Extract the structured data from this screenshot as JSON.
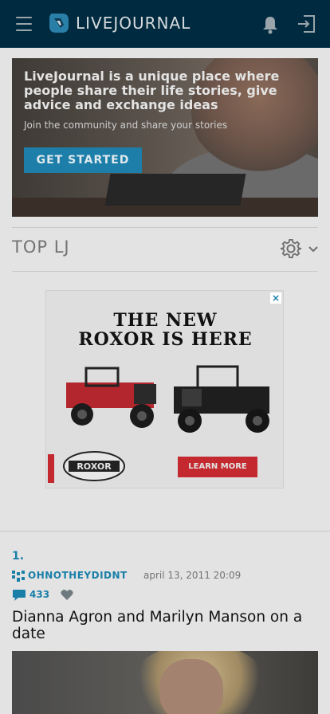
{
  "header": {
    "logo_text": "LIVEJOURNAL",
    "icons": [
      "menu-icon",
      "logo-icon",
      "bell-icon",
      "login-icon"
    ],
    "bg_color": "#002a3f"
  },
  "hero": {
    "title": "LiveJournal is a unique place where people share their life stories, give advice and exchange ideas",
    "subtitle": "Join the community and share your stories",
    "button_label": "GET STARTED",
    "accent_color": "#1d7fa9"
  },
  "top_section": {
    "title": "TOP LJ",
    "icons": [
      "gear-icon",
      "chevron-down-icon"
    ]
  },
  "ad": {
    "close_label": "×",
    "headline_line1": "THE NEW",
    "headline_line2": "ROXOR IS HERE",
    "brand": "ROXOR",
    "cta_label": "LEARN MORE"
  },
  "feed": {
    "items": [
      {
        "rank": "1.",
        "username": "OHNOTHEYDIDNT",
        "date": "april 13, 2011 20:09",
        "comments": "433",
        "title": "Dianna Agron and Marilyn Manson on a date"
      }
    ],
    "link_color": "#1a7fa8"
  }
}
